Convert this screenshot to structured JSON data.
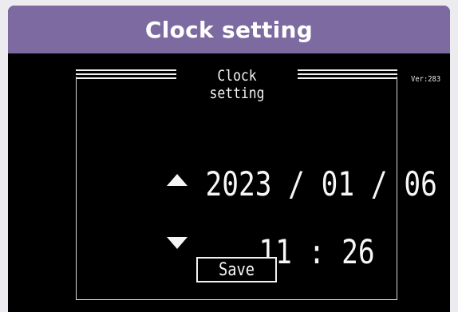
{
  "header": {
    "title": "Clock setting"
  },
  "screen": {
    "frame_title": "Clock setting",
    "version": "Ver:283",
    "date": {
      "year": "2023",
      "month": "01",
      "day": "06",
      "separator": " / "
    },
    "time": {
      "hour": "11",
      "minute": "26",
      "separator": " : "
    },
    "save_label": "Save"
  },
  "colors": {
    "header_bg": "#7c6aa0",
    "screen_bg": "#000000",
    "text": "#f7f7f7"
  },
  "icons": {
    "up": "up-triangle-icon",
    "down": "down-triangle-icon"
  }
}
